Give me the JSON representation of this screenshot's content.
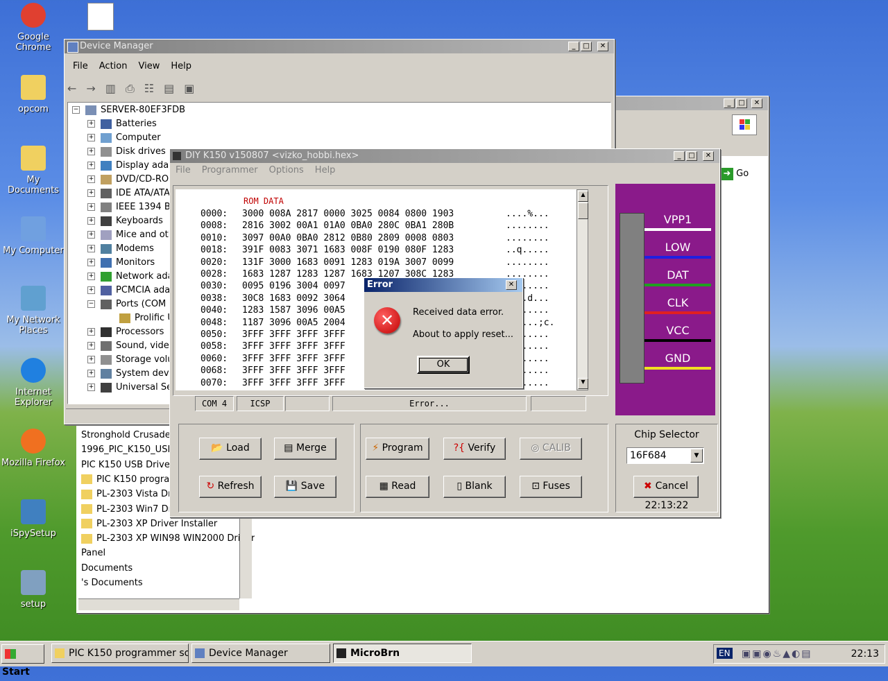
{
  "desktop_icons": [
    {
      "label": "Google Chrome",
      "icon": "chrome-icon"
    },
    {
      "label": "opcom",
      "icon": "folder-icon"
    },
    {
      "label": "My Documents",
      "icon": "my-documents-icon"
    },
    {
      "label": "My Computer",
      "icon": "my-computer-icon"
    },
    {
      "label": "My Network Places",
      "icon": "network-places-icon"
    },
    {
      "label": "Internet Explorer",
      "icon": "ie-icon"
    },
    {
      "label": "Mozilla Firefox",
      "icon": "firefox-icon"
    },
    {
      "label": "iSpySetup",
      "icon": "setup-icon"
    },
    {
      "label": "setup",
      "icon": "setup-cd-icon"
    }
  ],
  "device_manager": {
    "title": "Device Manager",
    "menu": [
      "File",
      "Action",
      "View",
      "Help"
    ],
    "root": "SERVER-80EF3FDB",
    "items": [
      "Batteries",
      "Computer",
      "Disk drives",
      "Display adapters",
      "DVD/CD-ROM drives",
      "IDE ATA/ATAPI controllers",
      "IEEE 1394 Bus host controllers",
      "Keyboards",
      "Mice and other pointing devices",
      "Modems",
      "Monitors",
      "Network adapters",
      "PCMCIA adapters",
      "Ports (COM & LPT)",
      "Prolific USB-to-Serial",
      "Processors",
      "Sound, video and game controllers",
      "Storage volumes",
      "System devices",
      "Universal Serial Bus controllers"
    ]
  },
  "explorer_back": {
    "go_label": "Go",
    "list": [
      "Stronghold Crusader",
      "1996_PIC_K150_USB_",
      "PIC K150 USB Driver",
      "PIC K150 programmer",
      "PL-2303 Vista Driver",
      "PL-2303 Win7 Driver",
      "PL-2303 XP Driver Installer",
      "PL-2303 XP WIN98 WIN2000 Driver",
      "Panel",
      "Documents",
      "'s Documents"
    ]
  },
  "k150": {
    "title": "DIY K150 v150807  <vizko_hobbi.hex>",
    "menu": [
      "File",
      "Programmer",
      "Options",
      "Help"
    ],
    "rom_header": "ROM DATA",
    "rows": [
      {
        "addr": "0000:",
        "data": "3000 008A 2817 0000 3025 0084 0800 1903",
        "ascii": "....%..."
      },
      {
        "addr": "0008:",
        "data": "2816 3002 00A1 01A0 0BA0 280C 0BA1 280B",
        "ascii": "........"
      },
      {
        "addr": "0010:",
        "data": "3097 00A0 0BA0 2812 0B80 2809 0008 0803",
        "ascii": "........"
      },
      {
        "addr": "0018:",
        "data": "391F 0083 3071 1683 008F 0190 080F 1283",
        "ascii": "..q....."
      },
      {
        "addr": "0020:",
        "data": "131F 3000 1683 0091 1283 019A 3007 0099",
        "ascii": "........"
      },
      {
        "addr": "0028:",
        "data": "1683 1287 1283 1287 1683 1207 308C 1283",
        "ascii": "........"
      },
      {
        "addr": "0030:",
        "data": "0095 0196 3004 0097",
        "ascii": "........"
      },
      {
        "addr": "0038:",
        "data": "30C8 1683 0092 3064",
        "ascii": "....d..."
      },
      {
        "addr": "0040:",
        "data": "1283 1587 3096 00A5",
        "ascii": "........"
      },
      {
        "addr": "0048:",
        "data": "1187 3096 00A5 2004",
        "ascii": "......;c."
      },
      {
        "addr": "0050:",
        "data": "3FFF 3FFF 3FFF 3FFF",
        "ascii": "........"
      },
      {
        "addr": "0058:",
        "data": "3FFF 3FFF 3FFF 3FFF",
        "ascii": "........"
      },
      {
        "addr": "0060:",
        "data": "3FFF 3FFF 3FFF 3FFF",
        "ascii": "........"
      },
      {
        "addr": "0068:",
        "data": "3FFF 3FFF 3FFF 3FFF",
        "ascii": "........"
      },
      {
        "addr": "0070:",
        "data": "3FFF 3FFF 3FFF 3FFF",
        "ascii": "........"
      }
    ],
    "status": {
      "port": "COM 4",
      "mode": "ICSP",
      "message": "Error..."
    },
    "pins": [
      {
        "label": "VPP1",
        "color": "#ffffff"
      },
      {
        "label": "LOW",
        "color": "#2020e0"
      },
      {
        "label": "DAT",
        "color": "#20a020"
      },
      {
        "label": "CLK",
        "color": "#e02020"
      },
      {
        "label": "VCC",
        "color": "#000000"
      },
      {
        "label": "GND",
        "color": "#f0e020"
      }
    ],
    "buttons": {
      "load": "Load",
      "merge": "Merge",
      "refresh": "Refresh",
      "save": "Save",
      "program": "Program",
      "verify": "Verify",
      "calib": "CALIB",
      "read": "Read",
      "blank": "Blank",
      "fuses": "Fuses",
      "cancel": "Cancel"
    },
    "chip_selector_label": "Chip Selector",
    "chip_value": "16F684",
    "clock": "22:13:22",
    "panel_color": "#8a1a8a"
  },
  "error_dialog": {
    "title": "Error",
    "line1": "Received data error.",
    "line2": "About to apply reset...",
    "ok": "OK"
  },
  "taskbar": {
    "start": "Start",
    "tasks": [
      "PIC K150 programmer so...",
      "Device Manager",
      "MicroBrn"
    ],
    "lang": "EN",
    "time": "22:13"
  }
}
